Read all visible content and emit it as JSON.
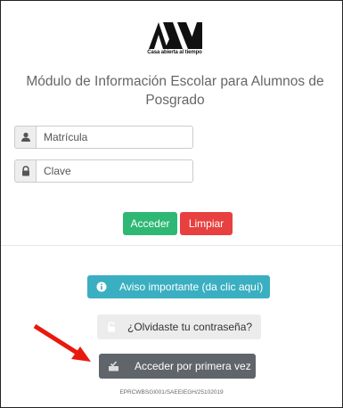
{
  "logo": {
    "caption": "Casa abierta al tiempo"
  },
  "title": {
    "line1": "Módulo de Información Escolar para Alumnos de",
    "line2": "Posgrado"
  },
  "form": {
    "matricula_placeholder": "Matrícula",
    "clave_placeholder": "Clave"
  },
  "buttons": {
    "acceder": "Acceder",
    "limpiar": "Limpiar",
    "aviso": "Aviso importante (da clic aquí)",
    "olvido": "¿Olvidaste tu contraseña?",
    "primera": "Acceder por primera vez"
  },
  "footer": {
    "code": "EPRCWBSGI001/SAEEIEGH/25102019"
  },
  "colors": {
    "acceder": "#2eb873",
    "limpiar": "#e84040",
    "aviso": "#3aafc1",
    "primera": "#60656b",
    "annotation_arrow": "#e8190f"
  },
  "icons": {
    "matricula": "user-icon",
    "clave": "lock-icon",
    "aviso": "info-icon",
    "olvido": "unlock-icon",
    "primera": "inbox-check-icon"
  }
}
